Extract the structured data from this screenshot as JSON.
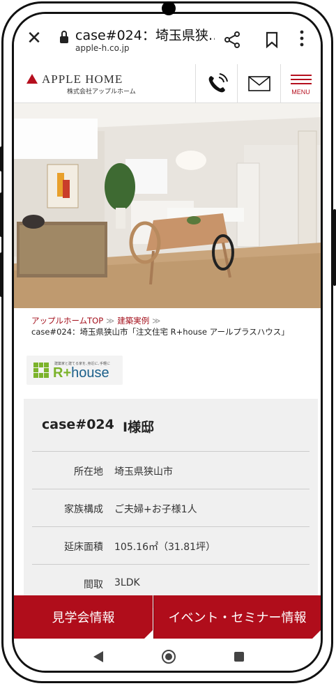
{
  "browser": {
    "title": "case#024：埼玉県狭…",
    "url": "apple-h.co.jp"
  },
  "site": {
    "logo_text": "APPLE HOME",
    "logo_sub": "株式会社アップルホーム",
    "menu_label": "MENU"
  },
  "breadcrumb": {
    "home": "アップルホームTOP",
    "section": "建築実例",
    "sep": "≫",
    "current": "case#024：埼玉県狭山市「注文住宅 R+house アールプラスハウス」"
  },
  "badge": {
    "tagline": "建築家と建てる家を､身近に､手軽に",
    "r_plus": "R+",
    "house": "house"
  },
  "case": {
    "number": "case#024",
    "name": "I様邸",
    "rows": [
      {
        "label": "所在地",
        "value": "埼玉県狭山市"
      },
      {
        "label": "家族構成",
        "value": "ご夫婦+お子様1人"
      },
      {
        "label": "延床面積",
        "value": "105.16㎡（31.81坪）"
      },
      {
        "label": "間取",
        "value": "3LDK"
      }
    ]
  },
  "cta": {
    "left": "見学会情報",
    "right": "イベント・セミナー情報"
  },
  "colors": {
    "brand_red": "#b00d1b",
    "link_red": "#a30f1b",
    "rhouse_green": "#7cb32b",
    "rhouse_blue": "#1a5f8a"
  }
}
